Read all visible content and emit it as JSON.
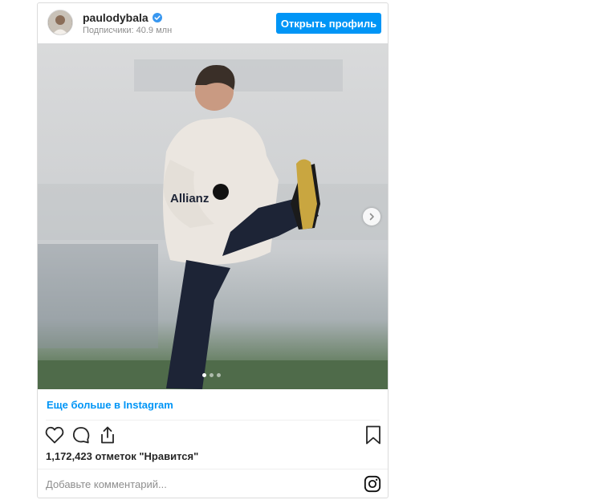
{
  "header": {
    "username": "paulodybala",
    "followers_text": "Подписчики: 40.9 млн",
    "open_profile_label": "Открыть профиль",
    "verified_icon": "verified-badge-icon",
    "accent_color": "#0095f6"
  },
  "post": {
    "image_alt": "Football player in training kit stretching his leg",
    "carousel": {
      "slide_count": 3,
      "active_index": 0
    },
    "more_link": "Еще больше в Instagram",
    "likes_text": "1,172,423 отметок \"Нравится\"",
    "comment_placeholder": "Добавьте комментарий...",
    "icons": [
      "heart-icon",
      "comment-icon",
      "share-icon",
      "bookmark-icon",
      "instagram-icon",
      "chevron-right-icon"
    ]
  }
}
